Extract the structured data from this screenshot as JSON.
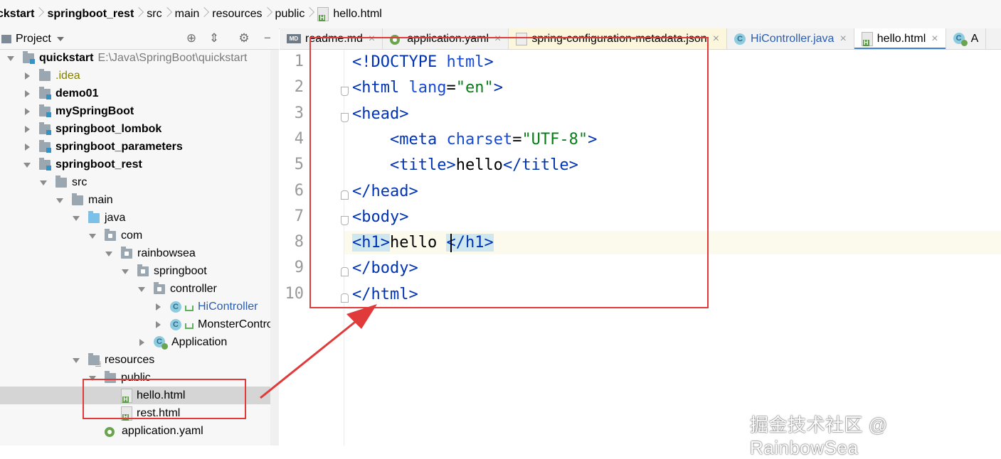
{
  "breadcrumb": [
    "ckstart",
    "springboot_rest",
    "src",
    "main",
    "resources",
    "public",
    "hello.html"
  ],
  "project_panel": {
    "title": "Project",
    "tools": {
      "locate": "⊕",
      "collapse": "⇕",
      "settings": "⚙",
      "hide": "−"
    }
  },
  "tree": [
    {
      "label": "quickstart",
      "path": "E:\\Java\\SpringBoot\\quickstart",
      "bold": true,
      "depth": 0,
      "arrow": "d",
      "icon": "folder-mod"
    },
    {
      "label": ".idea",
      "depth": 1,
      "arrow": "r",
      "icon": "folder",
      "style": "idea"
    },
    {
      "label": "demo01",
      "depth": 1,
      "arrow": "r",
      "icon": "folder-mod",
      "bold": true
    },
    {
      "label": "mySpringBoot",
      "depth": 1,
      "arrow": "r",
      "icon": "folder-mod",
      "bold": true
    },
    {
      "label": "springboot_lombok",
      "depth": 1,
      "arrow": "r",
      "icon": "folder-mod",
      "bold": true
    },
    {
      "label": "springboot_parameters",
      "depth": 1,
      "arrow": "r",
      "icon": "folder-mod",
      "bold": true
    },
    {
      "label": "springboot_rest",
      "depth": 1,
      "arrow": "d",
      "icon": "folder-mod",
      "bold": true
    },
    {
      "label": "src",
      "depth": 2,
      "arrow": "d",
      "icon": "folder"
    },
    {
      "label": "main",
      "depth": 3,
      "arrow": "d",
      "icon": "folder"
    },
    {
      "label": "java",
      "depth": 4,
      "arrow": "d",
      "icon": "folder-java"
    },
    {
      "label": "com",
      "depth": 5,
      "arrow": "d",
      "icon": "folder-pkg"
    },
    {
      "label": "rainbowsea",
      "depth": 6,
      "arrow": "d",
      "icon": "folder-pkg"
    },
    {
      "label": "springboot",
      "depth": 7,
      "arrow": "d",
      "icon": "folder-pkg"
    },
    {
      "label": "controller",
      "depth": 8,
      "arrow": "d",
      "icon": "folder-pkg"
    },
    {
      "label": "HiController",
      "depth": 9,
      "arrow": "r",
      "icon": "class-leaf",
      "style": "blue"
    },
    {
      "label": "MonsterController",
      "depth": 9,
      "arrow": "r",
      "icon": "class-leaf"
    },
    {
      "label": "Application",
      "depth": 8,
      "arrow": "r",
      "icon": "app"
    },
    {
      "label": "resources",
      "depth": 4,
      "arrow": "d",
      "icon": "folder-res"
    },
    {
      "label": "public",
      "depth": 5,
      "arrow": "d",
      "icon": "folder"
    },
    {
      "label": "hello.html",
      "depth": 6,
      "arrow": "n",
      "icon": "html",
      "selected": true
    },
    {
      "label": "rest.html",
      "depth": 6,
      "arrow": "n",
      "icon": "html"
    },
    {
      "label": "application.yaml",
      "depth": 5,
      "arrow": "n",
      "icon": "yaml"
    }
  ],
  "tabs": [
    {
      "label": "readme.md",
      "icon": "md"
    },
    {
      "label": "application.yaml",
      "icon": "yaml"
    },
    {
      "label": "spring-configuration-metadata.json",
      "icon": "json",
      "style": "meta"
    },
    {
      "label": "HiController.java",
      "icon": "class",
      "style": "blue"
    },
    {
      "label": "hello.html",
      "icon": "html",
      "active": true
    },
    {
      "label": "A",
      "icon": "app"
    }
  ],
  "tab_close": "×",
  "editor": {
    "line_numbers": [
      "1",
      "2",
      "3",
      "4",
      "5",
      "6",
      "7",
      "8",
      "9",
      "10"
    ],
    "lines": [
      [
        {
          "t": "tag",
          "s": "<!DOCTYPE "
        },
        {
          "t": "attr",
          "s": "html"
        },
        {
          "t": "tag",
          "s": ">"
        }
      ],
      [
        {
          "t": "tag",
          "s": "<html "
        },
        {
          "t": "attr",
          "s": "lang"
        },
        {
          "t": "txt",
          "s": "="
        },
        {
          "t": "val",
          "s": "\"en\""
        },
        {
          "t": "tag",
          "s": ">"
        }
      ],
      [
        {
          "t": "tag",
          "s": "<head>"
        }
      ],
      [
        {
          "t": "txt",
          "s": "    "
        },
        {
          "t": "tag",
          "s": "<meta "
        },
        {
          "t": "attr",
          "s": "charset"
        },
        {
          "t": "txt",
          "s": "="
        },
        {
          "t": "val",
          "s": "\"UTF-8\""
        },
        {
          "t": "tag",
          "s": ">"
        }
      ],
      [
        {
          "t": "txt",
          "s": "    "
        },
        {
          "t": "tag",
          "s": "<title>"
        },
        {
          "t": "txt",
          "s": "hello"
        },
        {
          "t": "tag",
          "s": "</title>"
        }
      ],
      [
        {
          "t": "tag",
          "s": "</head>"
        }
      ],
      [
        {
          "t": "tag",
          "s": "<body>"
        }
      ],
      [
        {
          "t": "tag hl",
          "s": "<h1>"
        },
        {
          "t": "txt",
          "s": "hello "
        },
        {
          "t": "tag hl",
          "s": "</h1>"
        }
      ],
      [
        {
          "t": "tag",
          "s": "</body>"
        }
      ],
      [
        {
          "t": "tag",
          "s": "</html>"
        }
      ]
    ]
  },
  "watermark": "掘金技术社区 @ RainbowSea",
  "colors": {
    "annotation": "#e03a3a",
    "tag": "#0033b3",
    "attr": "#174ad4",
    "value": "#067d17",
    "selection": "#d5d5d5"
  }
}
